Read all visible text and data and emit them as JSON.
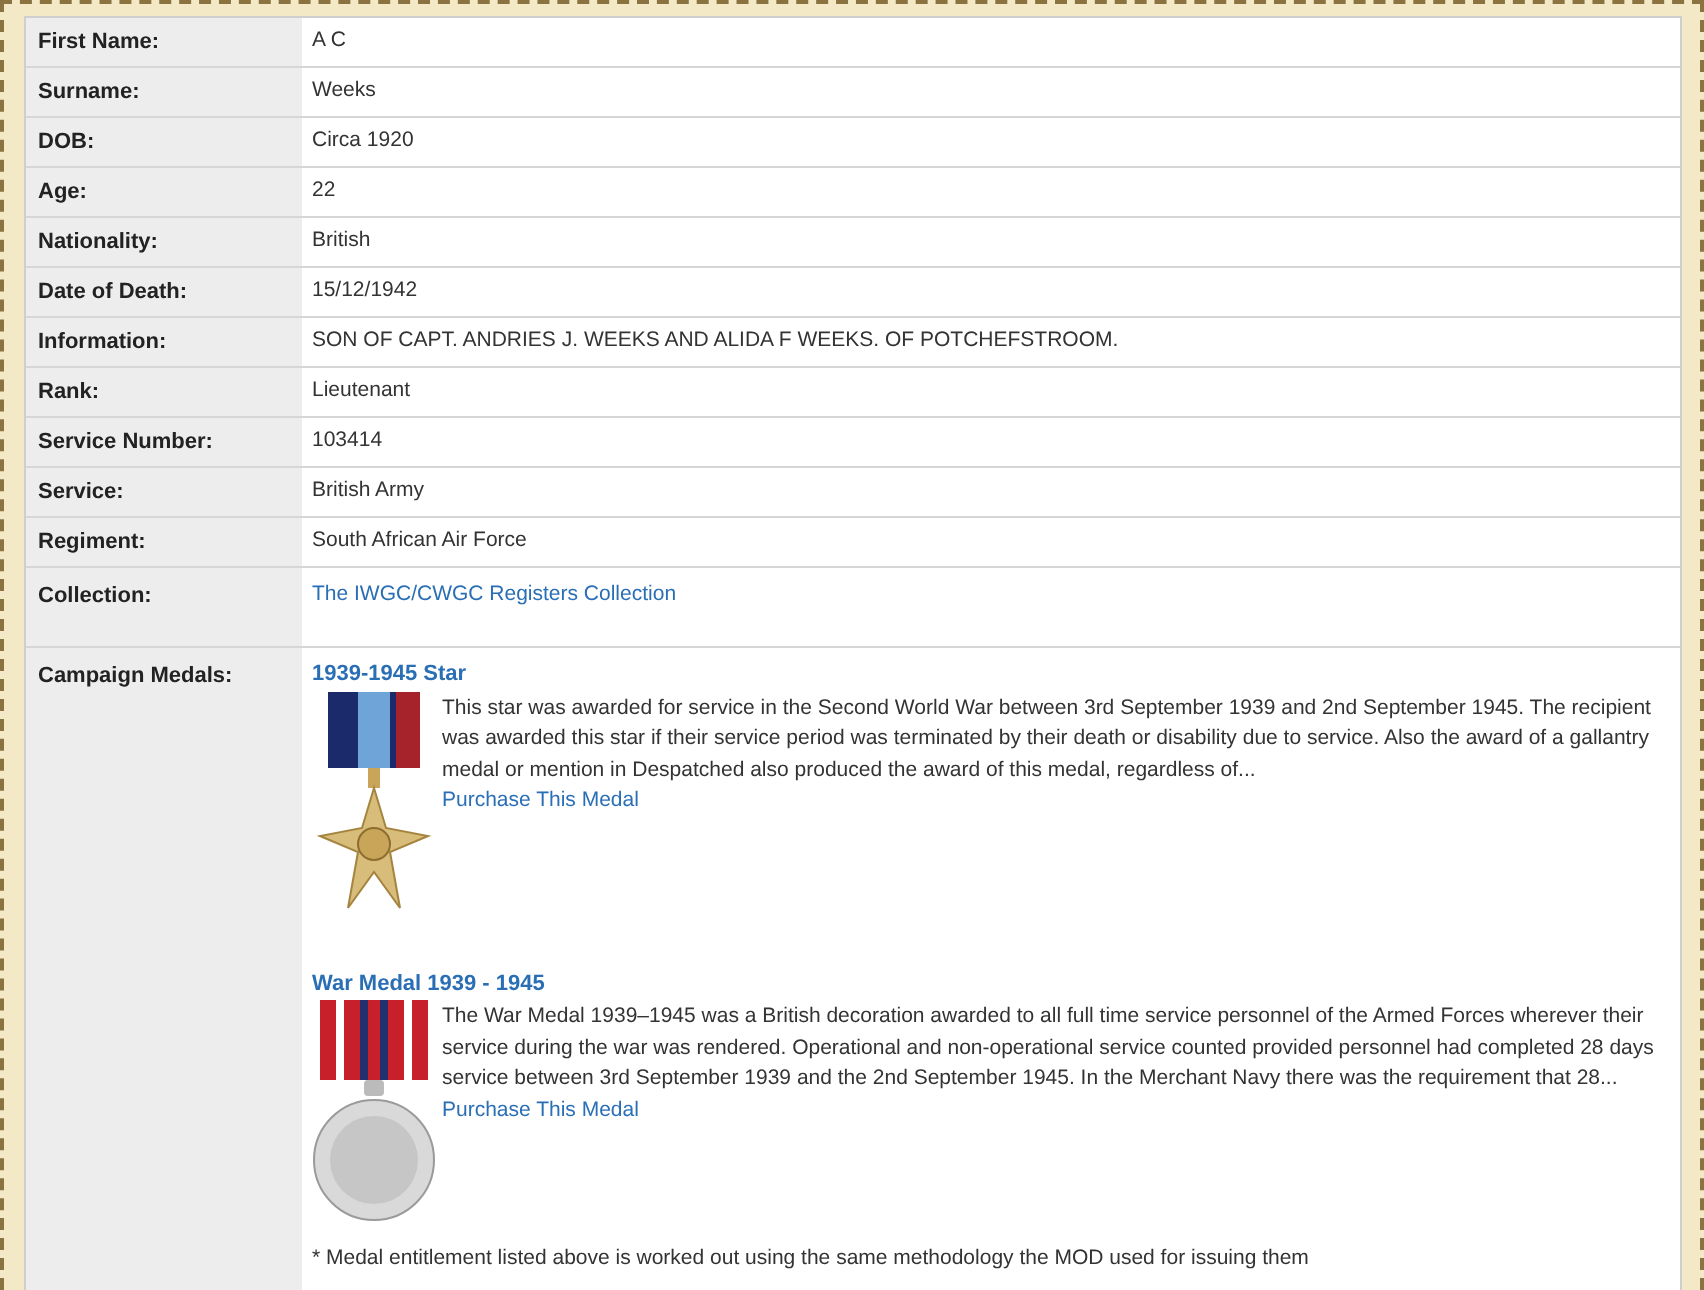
{
  "fields": [
    {
      "label": "First Name:",
      "value": "A C"
    },
    {
      "label": "Surname:",
      "value": "Weeks"
    },
    {
      "label": "DOB:",
      "value": "Circa 1920"
    },
    {
      "label": "Age:",
      "value": "22"
    },
    {
      "label": "Nationality:",
      "value": "British"
    },
    {
      "label": "Date of Death:",
      "value": "15/12/1942"
    },
    {
      "label": "Information:",
      "value": "SON OF CAPT. ANDRIES J. WEEKS AND ALIDA F WEEKS. OF POTCHEFSTROOM."
    },
    {
      "label": "Rank:",
      "value": "Lieutenant"
    },
    {
      "label": "Service Number:",
      "value": "103414"
    },
    {
      "label": "Service:",
      "value": "British Army"
    },
    {
      "label": "Regiment:",
      "value": "South African Air Force"
    },
    {
      "label": "Collection:",
      "value": "The IWGC/CWGC Registers Collection",
      "kind": "link"
    }
  ],
  "campaign_medals": {
    "label": "Campaign Medals:",
    "medals": [
      {
        "title": "1939-1945 Star",
        "kind": "star",
        "description": "This star was awarded for service in the Second World War between 3rd September 1939 and 2nd September 1945. The recipient was awarded this star if their service period was terminated by their death or disability due to service. Also the award of a gallantry medal or mention in Despatched also produced the award of this medal, regardless of...",
        "link": "Purchase This Medal"
      },
      {
        "title": "War Medal 1939 - 1945",
        "kind": "round",
        "description": "The War Medal 1939–1945 was a British decoration awarded to all full time service personnel of the Armed Forces wherever their service during the war was rendered. Operational and non-operational service counted provided personnel had completed 28 days service between 3rd September 1939 and the 2nd September 1945. In the Merchant Navy there was the requirement that 28...",
        "link": "Purchase This Medal"
      }
    ],
    "footnote": "* Medal entitlement listed above is worked out using the same methodology the MOD used for issuing them"
  }
}
